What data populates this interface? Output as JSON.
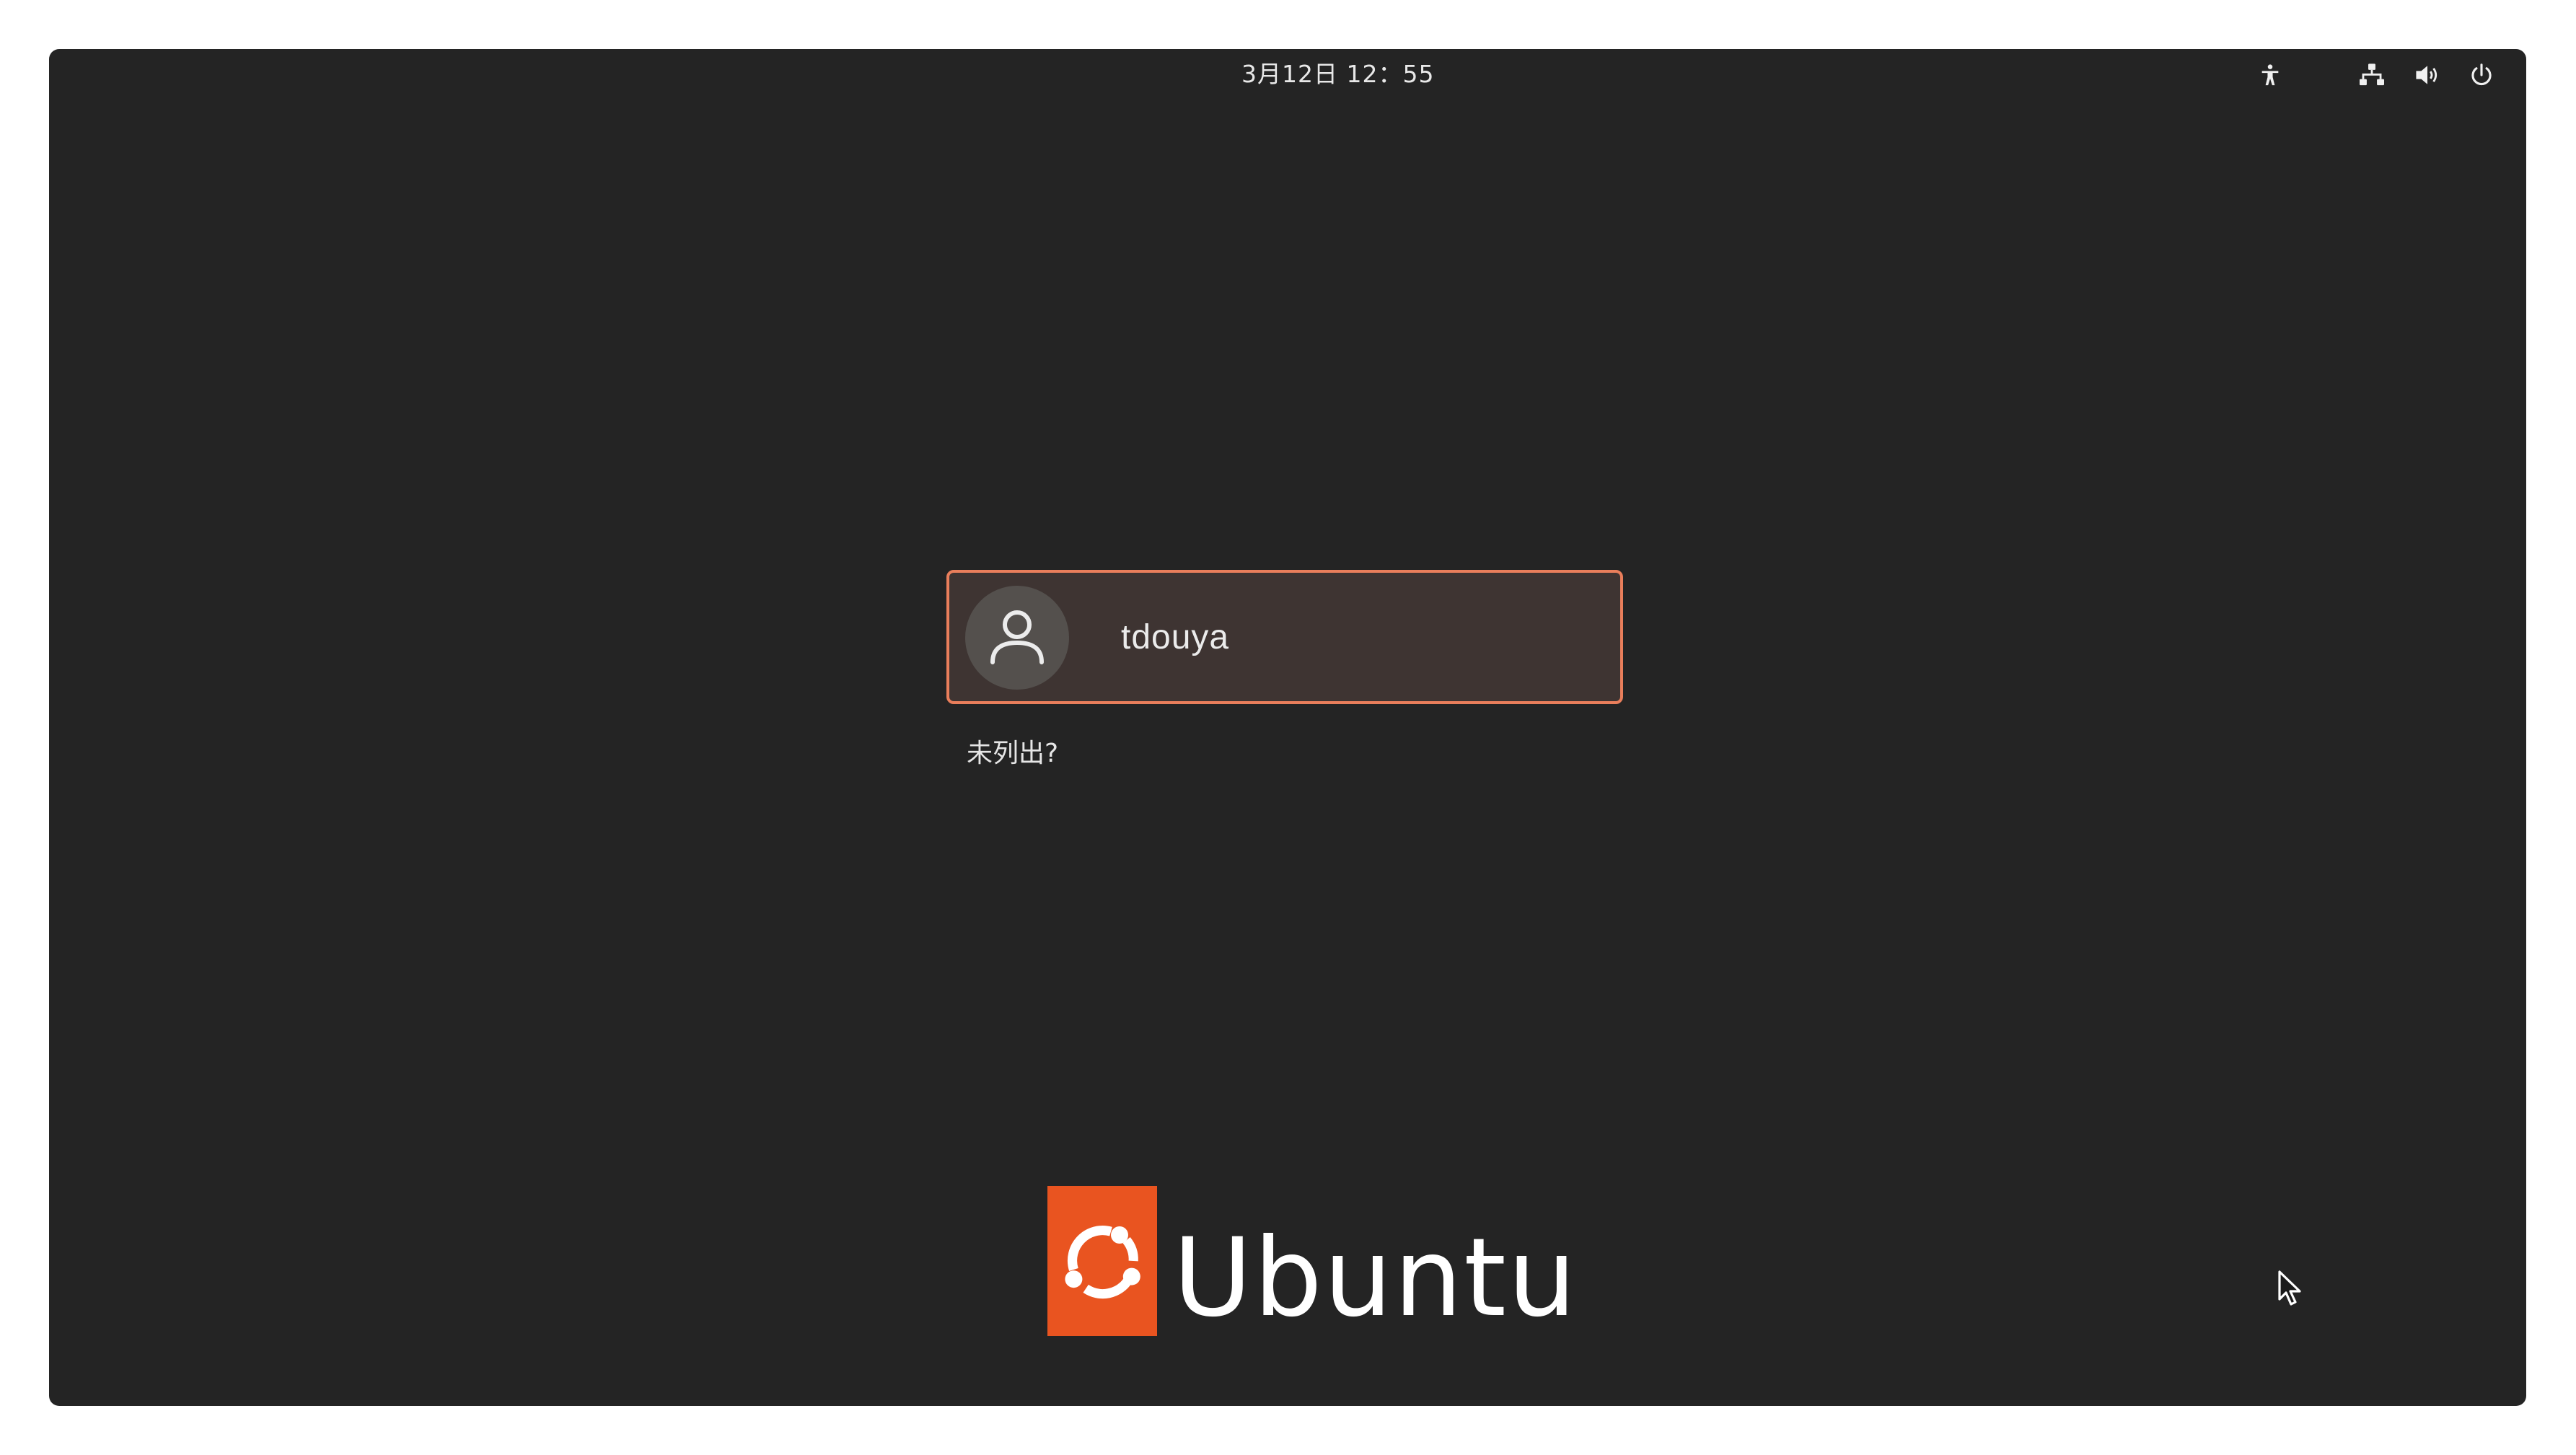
{
  "topbar": {
    "datetime": "3月12日  12：55",
    "icons": [
      "accessibility-icon",
      "network-icon",
      "volume-icon",
      "power-icon"
    ]
  },
  "login": {
    "username": "tdouya",
    "not_listed_label": "未列出?"
  },
  "logo": {
    "wordmark": "Ubuntu"
  },
  "colors": {
    "background": "#242424",
    "accent_border": "#e97e5b",
    "card_fill": "#3e3432",
    "brand_orange": "#e95420"
  }
}
